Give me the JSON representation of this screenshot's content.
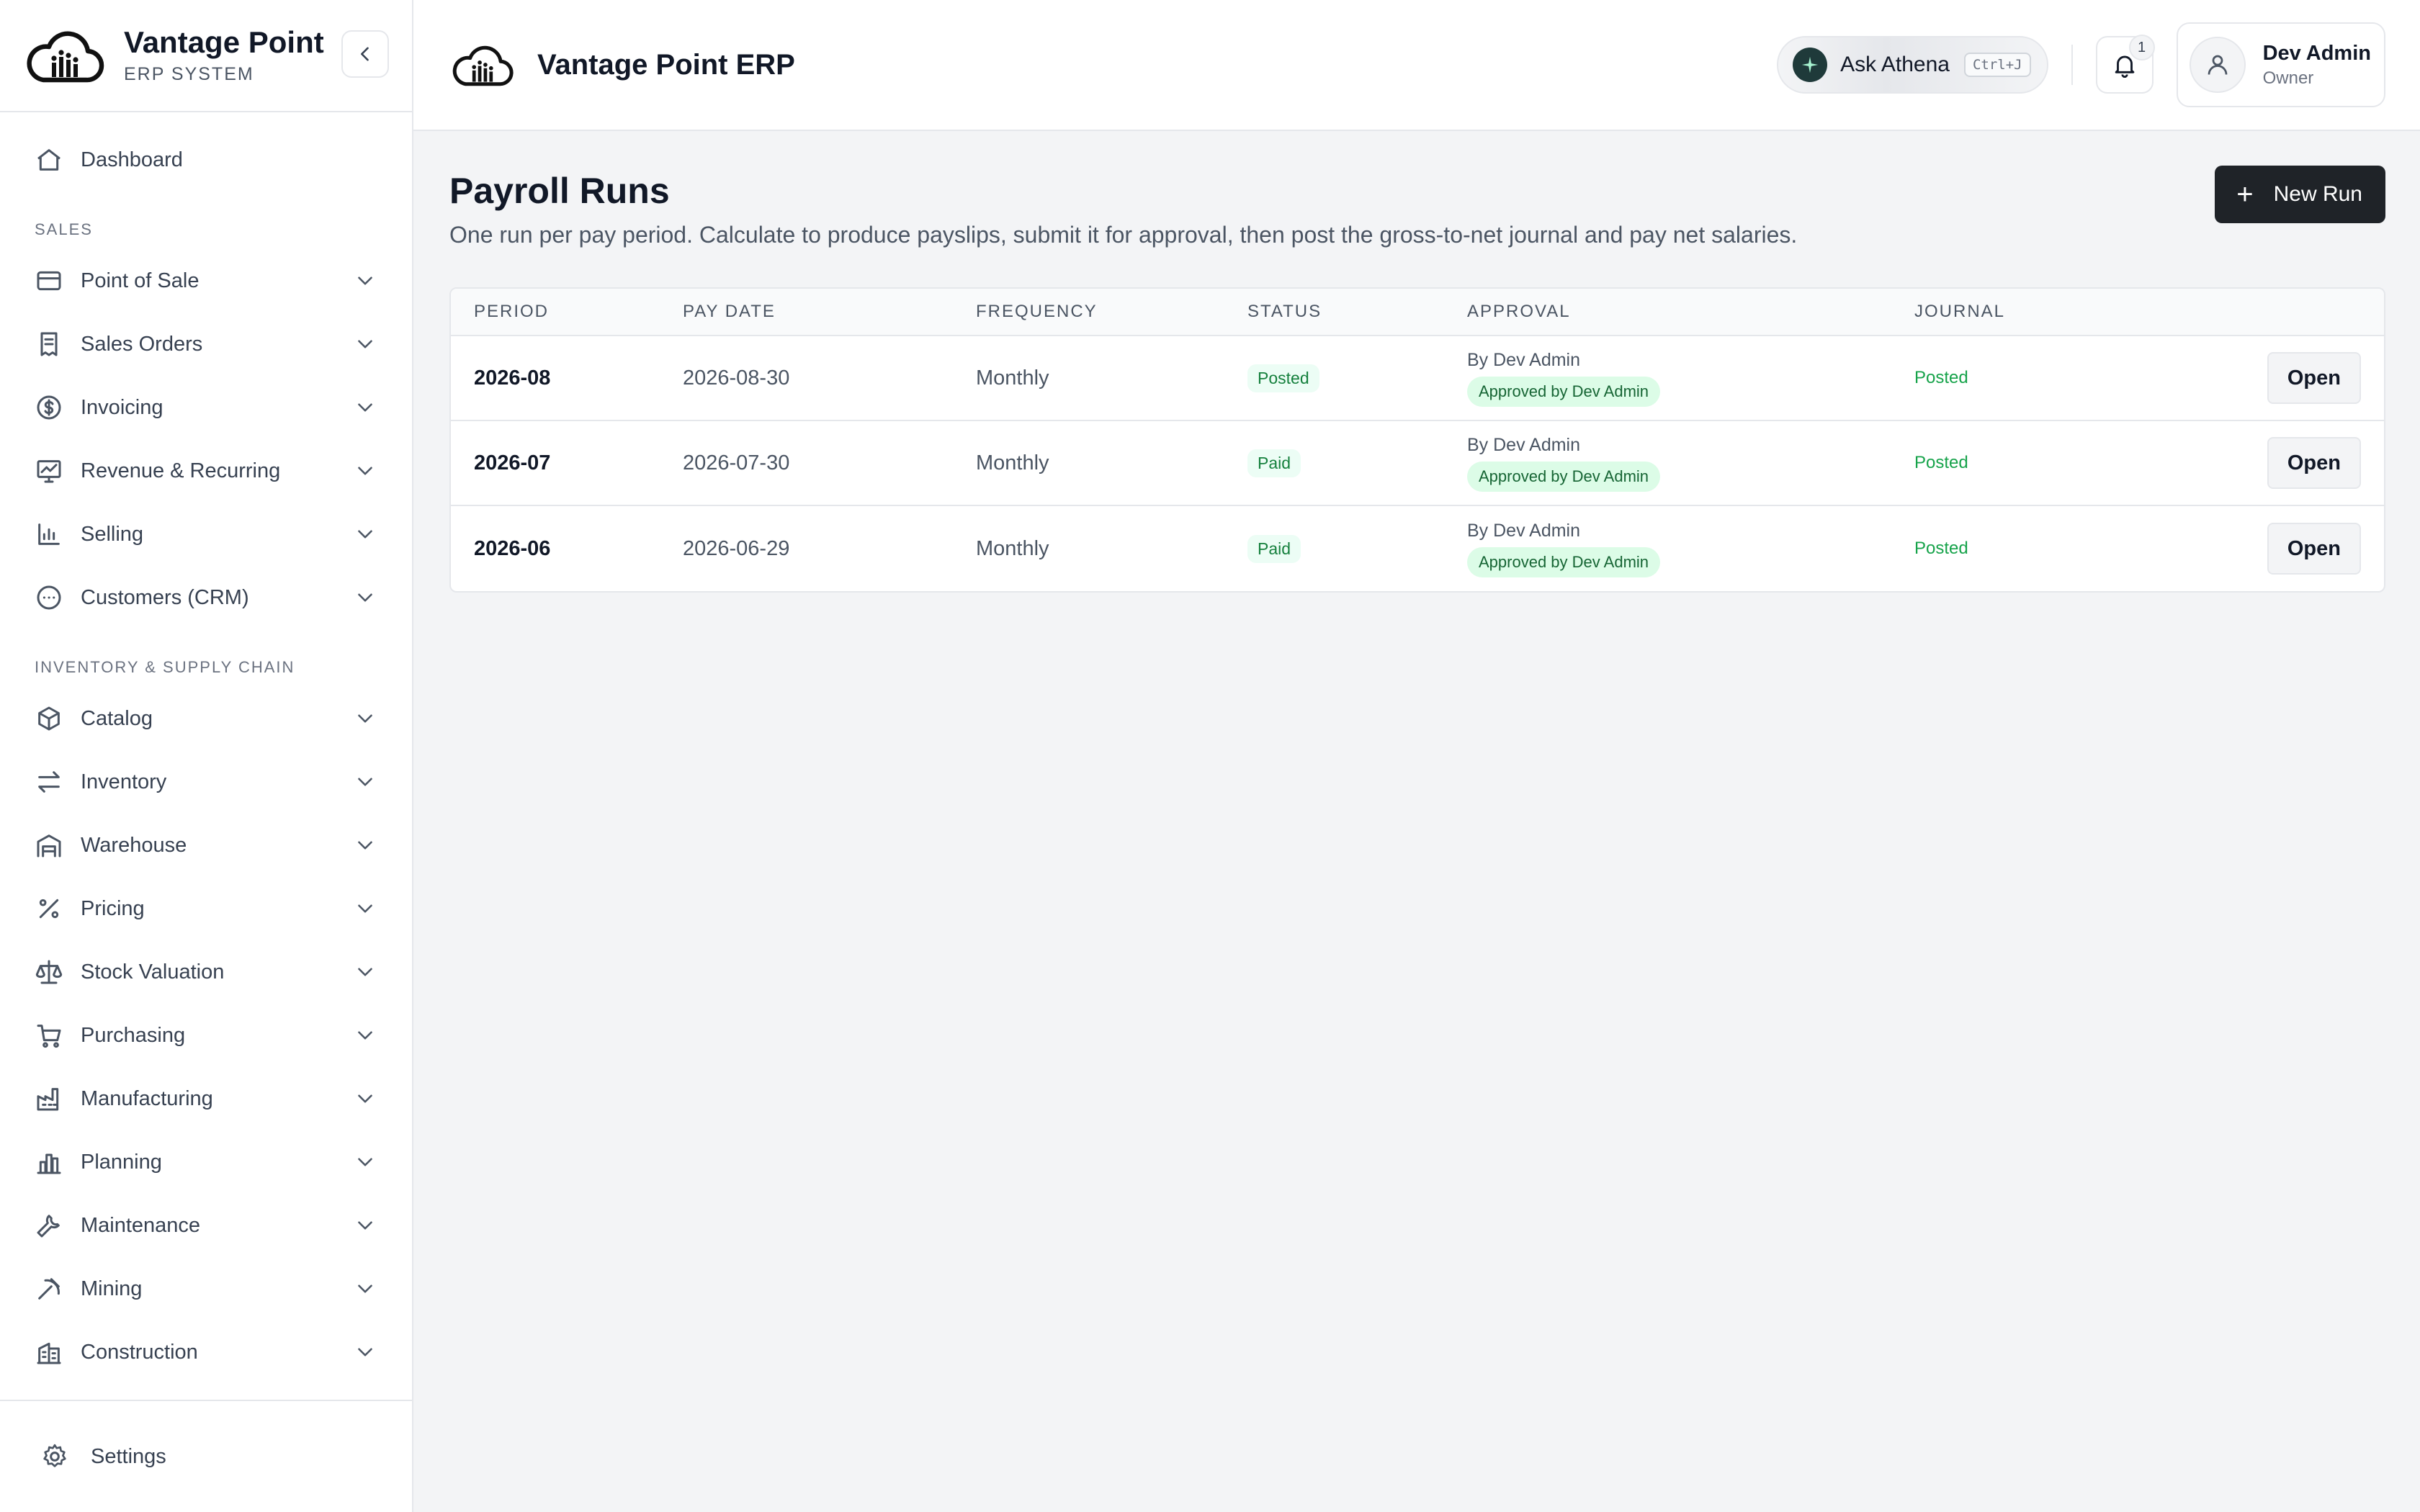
{
  "sidebar": {
    "brand_name": "Vantage Point",
    "brand_sub": "ERP SYSTEM",
    "dashboard": "Dashboard",
    "sections": [
      {
        "title": "SALES",
        "items": [
          {
            "label": "Point of Sale",
            "icon": "card-icon"
          },
          {
            "label": "Sales Orders",
            "icon": "receipt-icon"
          },
          {
            "label": "Invoicing",
            "icon": "dollar-icon"
          },
          {
            "label": "Revenue & Recurring",
            "icon": "trend-icon"
          },
          {
            "label": "Selling",
            "icon": "bar-chart-icon"
          },
          {
            "label": "Customers (CRM)",
            "icon": "chat-icon"
          }
        ]
      },
      {
        "title": "INVENTORY & SUPPLY CHAIN",
        "items": [
          {
            "label": "Catalog",
            "icon": "box-icon"
          },
          {
            "label": "Inventory",
            "icon": "arrows-icon"
          },
          {
            "label": "Warehouse",
            "icon": "warehouse-icon"
          },
          {
            "label": "Pricing",
            "icon": "percent-icon"
          },
          {
            "label": "Stock Valuation",
            "icon": "scale-icon"
          },
          {
            "label": "Purchasing",
            "icon": "cart-icon"
          },
          {
            "label": "Manufacturing",
            "icon": "factory-icon"
          },
          {
            "label": "Planning",
            "icon": "columns-icon"
          },
          {
            "label": "Maintenance",
            "icon": "wrench-icon"
          },
          {
            "label": "Mining",
            "icon": "pickaxe-icon"
          },
          {
            "label": "Construction",
            "icon": "building-icon"
          }
        ]
      }
    ],
    "settings": "Settings"
  },
  "topbar": {
    "app_title": "Vantage Point ERP",
    "athena_label": "Ask Athena",
    "athena_shortcut": "Ctrl+J",
    "notification_count": "1",
    "user_name": "Dev Admin",
    "user_role": "Owner"
  },
  "page": {
    "title": "Payroll Runs",
    "description": "One run per pay period. Calculate to produce payslips, submit it for approval, then post the gross-to-net journal and pay net salaries.",
    "new_run_label": "New Run"
  },
  "table": {
    "headers": [
      "PERIOD",
      "PAY DATE",
      "FREQUENCY",
      "STATUS",
      "APPROVAL",
      "JOURNAL"
    ],
    "rows": [
      {
        "period": "2026-08",
        "pay_date": "2026-08-30",
        "frequency": "Monthly",
        "status": "Posted",
        "approval_by": "By Dev Admin",
        "approval_badge": "Approved by Dev Admin",
        "journal": "Posted",
        "action": "Open"
      },
      {
        "period": "2026-07",
        "pay_date": "2026-07-30",
        "frequency": "Monthly",
        "status": "Paid",
        "approval_by": "By Dev Admin",
        "approval_badge": "Approved by Dev Admin",
        "journal": "Posted",
        "action": "Open"
      },
      {
        "period": "2026-06",
        "pay_date": "2026-06-29",
        "frequency": "Monthly",
        "status": "Paid",
        "approval_by": "By Dev Admin",
        "approval_badge": "Approved by Dev Admin",
        "journal": "Posted",
        "action": "Open"
      }
    ]
  },
  "colors": {
    "primary_button": "#1f2328",
    "status_green": "#15803d",
    "badge_green_bg": "#dcfce7"
  }
}
